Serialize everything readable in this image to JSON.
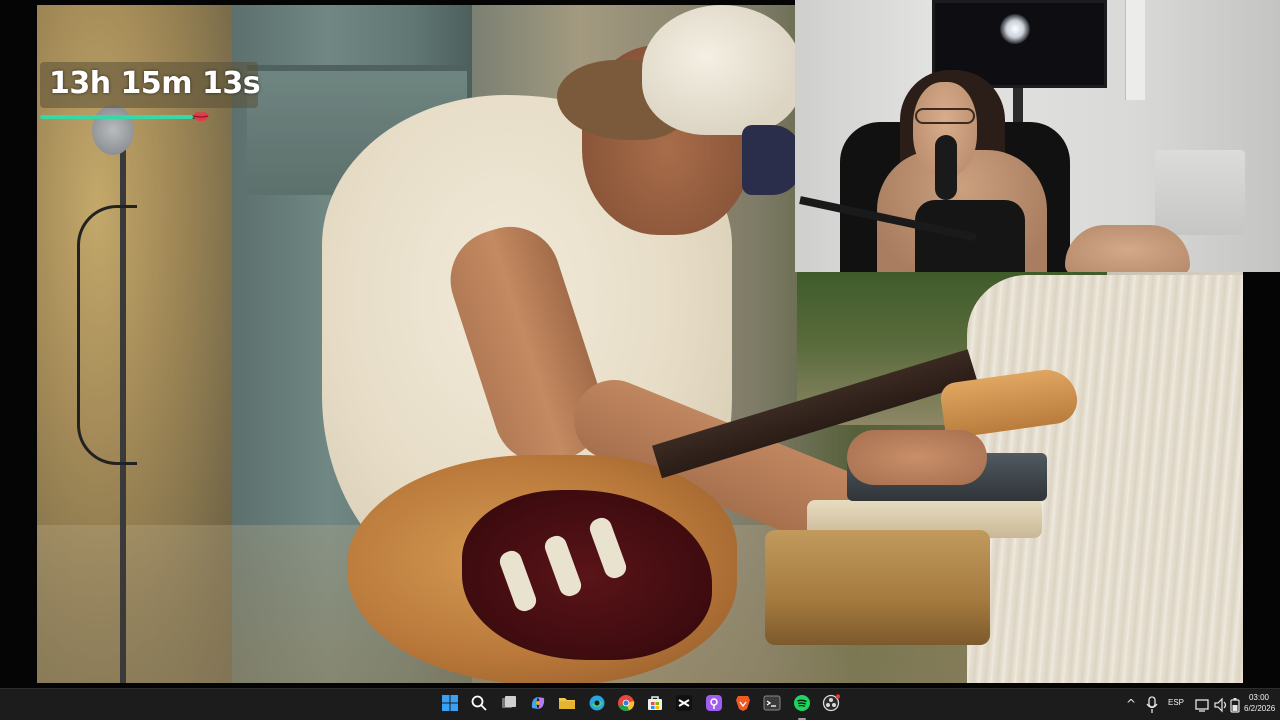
{
  "stream": {
    "timer_text": "13h 15m 13s",
    "timer_progress": 0.93,
    "timer_bar_color": "#36d8a7",
    "timer_marker_icon": "lips-icon"
  },
  "taskbar": {
    "apps": [
      {
        "name": "start-button",
        "icon": "windows-icon",
        "color": "#3aa0f3"
      },
      {
        "name": "search-button",
        "icon": "search-icon",
        "color": "#ffffff"
      },
      {
        "name": "task-view-button",
        "icon": "task-view-icon",
        "color": "#d0d0d0"
      },
      {
        "name": "copilot-button",
        "icon": "copilot-icon",
        "color": "#b17bf3"
      },
      {
        "name": "file-explorer-button",
        "icon": "folder-icon",
        "color": "#f2c94c"
      },
      {
        "name": "edge-button",
        "icon": "edge-icon",
        "color": "#2aa4e0"
      },
      {
        "name": "chrome-button",
        "icon": "chrome-icon",
        "color": "#e7473c"
      },
      {
        "name": "store-button",
        "icon": "store-icon",
        "color": "#2d8cff"
      },
      {
        "name": "capcut-button",
        "icon": "capcut-icon",
        "color": "#ffffff"
      },
      {
        "name": "podcast-app-button",
        "icon": "podcast-icon",
        "color": "#a35cf0"
      },
      {
        "name": "brave-button",
        "icon": "brave-icon",
        "color": "#f25a24"
      },
      {
        "name": "terminal-button",
        "icon": "terminal-icon",
        "color": "#3a3a3a"
      },
      {
        "name": "spotify-button",
        "icon": "spotify-icon",
        "color": "#1ed760"
      },
      {
        "name": "obs-button",
        "icon": "obs-icon",
        "color": "#d9d9d9"
      }
    ],
    "tray": {
      "chevron_icon": "chevron-up-icon",
      "mic_icon": "microphone-icon",
      "language": "ESP",
      "network_icon": "network-icon",
      "volume_icon": "speaker-icon",
      "battery_icon": "battery-icon",
      "time": "03:00",
      "date": "6/2/2026"
    }
  }
}
